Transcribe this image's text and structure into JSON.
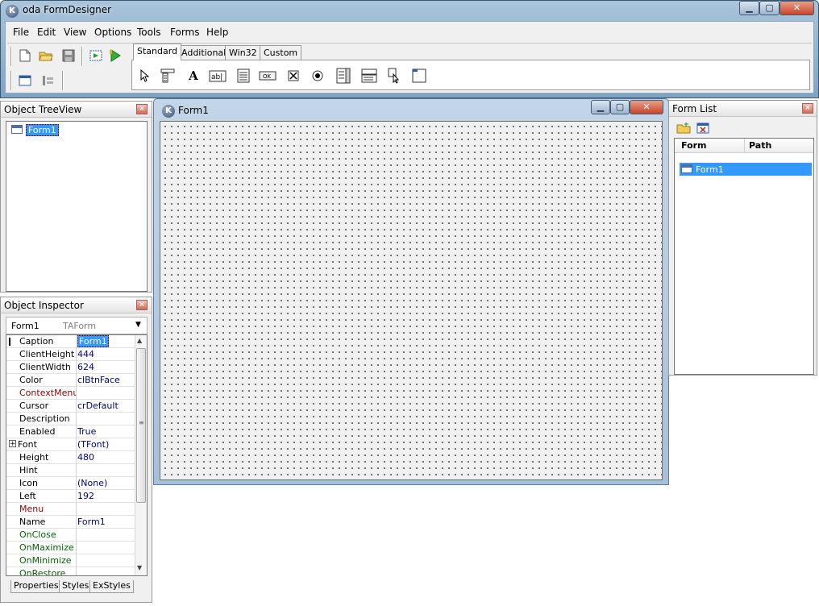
{
  "app": {
    "title": "oda FormDesigner",
    "icon_letter": "K",
    "caption_buttons": {
      "minimize": "▁",
      "maximize": "▢",
      "close": "✕"
    }
  },
  "menu": {
    "items": [
      "File",
      "Edit",
      "View",
      "Options",
      "Tools",
      "Forms",
      "Help"
    ]
  },
  "toolbar": {
    "buttons": [
      "new-file-icon",
      "open-folder-icon",
      "save-icon",
      "run-form-icon",
      "run-icon",
      "form-window-icon",
      "component-order-icon"
    ]
  },
  "palette": {
    "tabs": [
      "Standard",
      "Additional",
      "Win32",
      "Custom"
    ],
    "active_tab": "Standard",
    "components": [
      "pointer-icon",
      "main-menu-icon",
      "label-icon",
      "edit-icon",
      "memo-icon",
      "button-icon",
      "checkbox-icon",
      "radio-icon",
      "listbox-icon",
      "combobox-icon",
      "scrollbar-icon",
      "panel-icon"
    ],
    "button_caption": "OK",
    "edit_caption": "ab|"
  },
  "tree_view": {
    "title": "Object TreeView",
    "close": "×",
    "items": [
      {
        "label": "Form1",
        "selected": true
      }
    ]
  },
  "inspector": {
    "title": "Object Inspector",
    "close": "×",
    "object_name": "Form1",
    "object_type": "TAForm",
    "properties": [
      {
        "name": "Caption",
        "value": "Form1",
        "kind": "prop",
        "selected": true
      },
      {
        "name": "ClientHeight",
        "value": "444",
        "kind": "prop"
      },
      {
        "name": "ClientWidth",
        "value": "624",
        "kind": "prop"
      },
      {
        "name": "Color",
        "value": "clBtnFace",
        "kind": "prop"
      },
      {
        "name": "ContextMenu",
        "value": "",
        "kind": "ref"
      },
      {
        "name": "Cursor",
        "value": "crDefault",
        "kind": "prop"
      },
      {
        "name": "Description",
        "value": "",
        "kind": "prop"
      },
      {
        "name": "Enabled",
        "value": "True",
        "kind": "prop"
      },
      {
        "name": "Font",
        "value": "(TFont)",
        "kind": "prop",
        "expandable": true
      },
      {
        "name": "Height",
        "value": "480",
        "kind": "prop"
      },
      {
        "name": "Hint",
        "value": "",
        "kind": "prop"
      },
      {
        "name": "Icon",
        "value": "(None)",
        "kind": "prop"
      },
      {
        "name": "Left",
        "value": "192",
        "kind": "prop"
      },
      {
        "name": "Menu",
        "value": "",
        "kind": "ref"
      },
      {
        "name": "Name",
        "value": "Form1",
        "kind": "prop"
      },
      {
        "name": "OnClose",
        "value": "",
        "kind": "event"
      },
      {
        "name": "OnMaximize",
        "value": "",
        "kind": "event"
      },
      {
        "name": "OnMinimize",
        "value": "",
        "kind": "event"
      },
      {
        "name": "OnRestore",
        "value": "",
        "kind": "event"
      }
    ],
    "tabs": [
      "Properties",
      "Styles",
      "ExStyles"
    ]
  },
  "form_window": {
    "title": "Form1",
    "icon_letter": "K"
  },
  "form_list": {
    "title": "Form List",
    "close": "×",
    "columns": [
      "Form",
      "Path"
    ],
    "rows": [
      {
        "form": "Form1",
        "path": "",
        "selected": true
      }
    ]
  }
}
